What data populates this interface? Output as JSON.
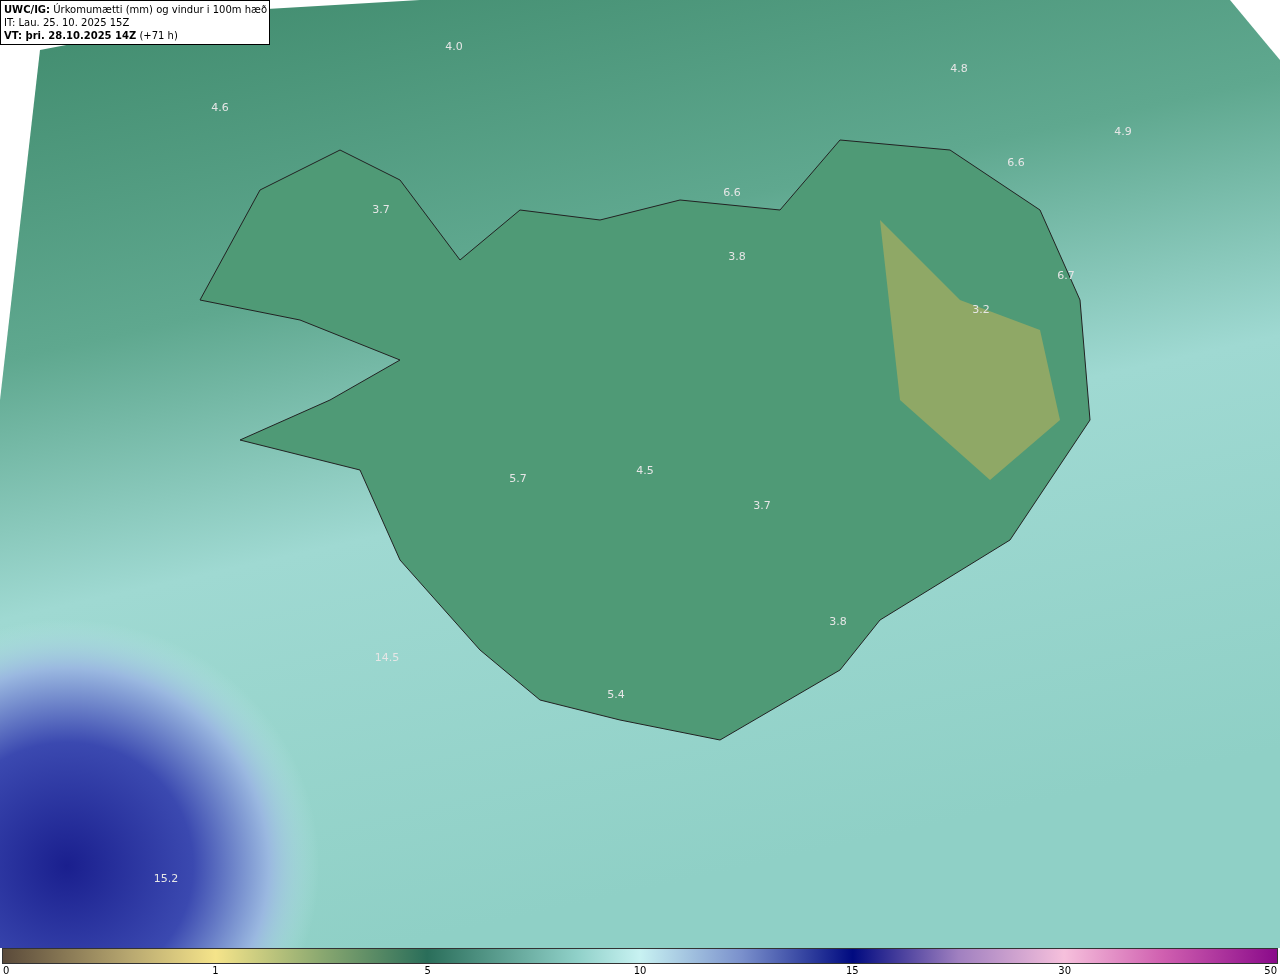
{
  "header": {
    "lines": [
      "**UWC/IG:** Úrkomumætti (mm) og vindur i 100m hæð",
      "IT: Lau. 25. 10. 2025 15Z",
      "**VT: þri. 28.10.2025 14Z** (+71 h)"
    ]
  },
  "map": {
    "value_labels": [
      "4.0",
      "4.8",
      "4.6",
      "4.9",
      "6.6",
      "6.6",
      "3.7",
      "3.8",
      "6.7",
      "3.2",
      "4.5",
      "5.7",
      "3.7",
      "3.8",
      "14.5",
      "5.4",
      "15.2"
    ]
  },
  "colorbar": {
    "ticks": [
      "0",
      "1",
      "5",
      "10",
      "15",
      "30",
      "50"
    ]
  }
}
